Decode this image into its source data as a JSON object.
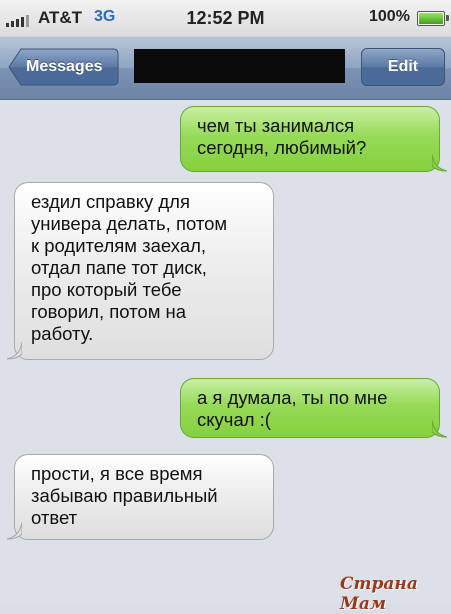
{
  "status_bar": {
    "carrier": "AT&T",
    "network": "3G",
    "time": "12:52 PM",
    "battery": "100%",
    "battery_level": 1.0
  },
  "nav": {
    "back_label": "Messages",
    "edit_label": "Edit"
  },
  "messages": [
    {
      "direction": "sent",
      "text": "чем ты занимался\nсегодня, любимый?"
    },
    {
      "direction": "received",
      "text": "ездил справку для\nунивера делать, потом\nк родителям заехал,\nотдал папе тот диск,\nпро который тебе\nговорил, потом на\nработу."
    },
    {
      "direction": "sent",
      "text": "а я думала, ты по мне\nскучал :("
    },
    {
      "direction": "received",
      "text": "прости, я все время\nзабываю правильный\nответ"
    }
  ],
  "watermark": "Страна Мам",
  "colors": {
    "sent_bubble": "#8fd64a",
    "received_bubble": "#e8e8e8",
    "nav_bar": "#8ea4c2",
    "background": "#dbe0e9"
  }
}
